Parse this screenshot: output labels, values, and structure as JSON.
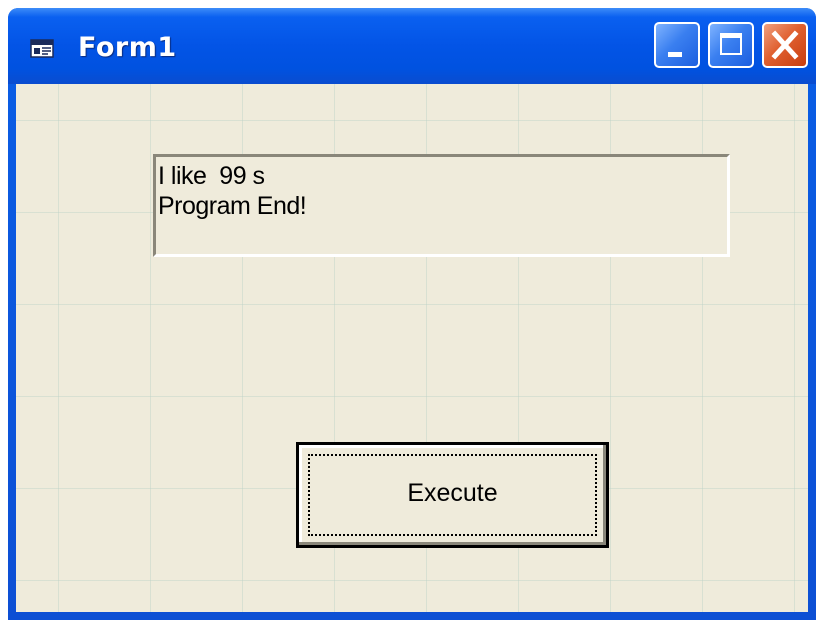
{
  "window": {
    "title": "Form1",
    "icon": "form-window-icon",
    "controls": {
      "minimize_icon": "minimize-icon",
      "maximize_icon": "maximize-icon",
      "close_icon": "close-icon"
    }
  },
  "output": {
    "lines": [
      "I like  99 s",
      "Program End!"
    ]
  },
  "execute_button": {
    "label": "Execute"
  },
  "colors": {
    "titlebar": "#0354e6",
    "client_background": "#efebdb",
    "close_button": "#e06030"
  }
}
